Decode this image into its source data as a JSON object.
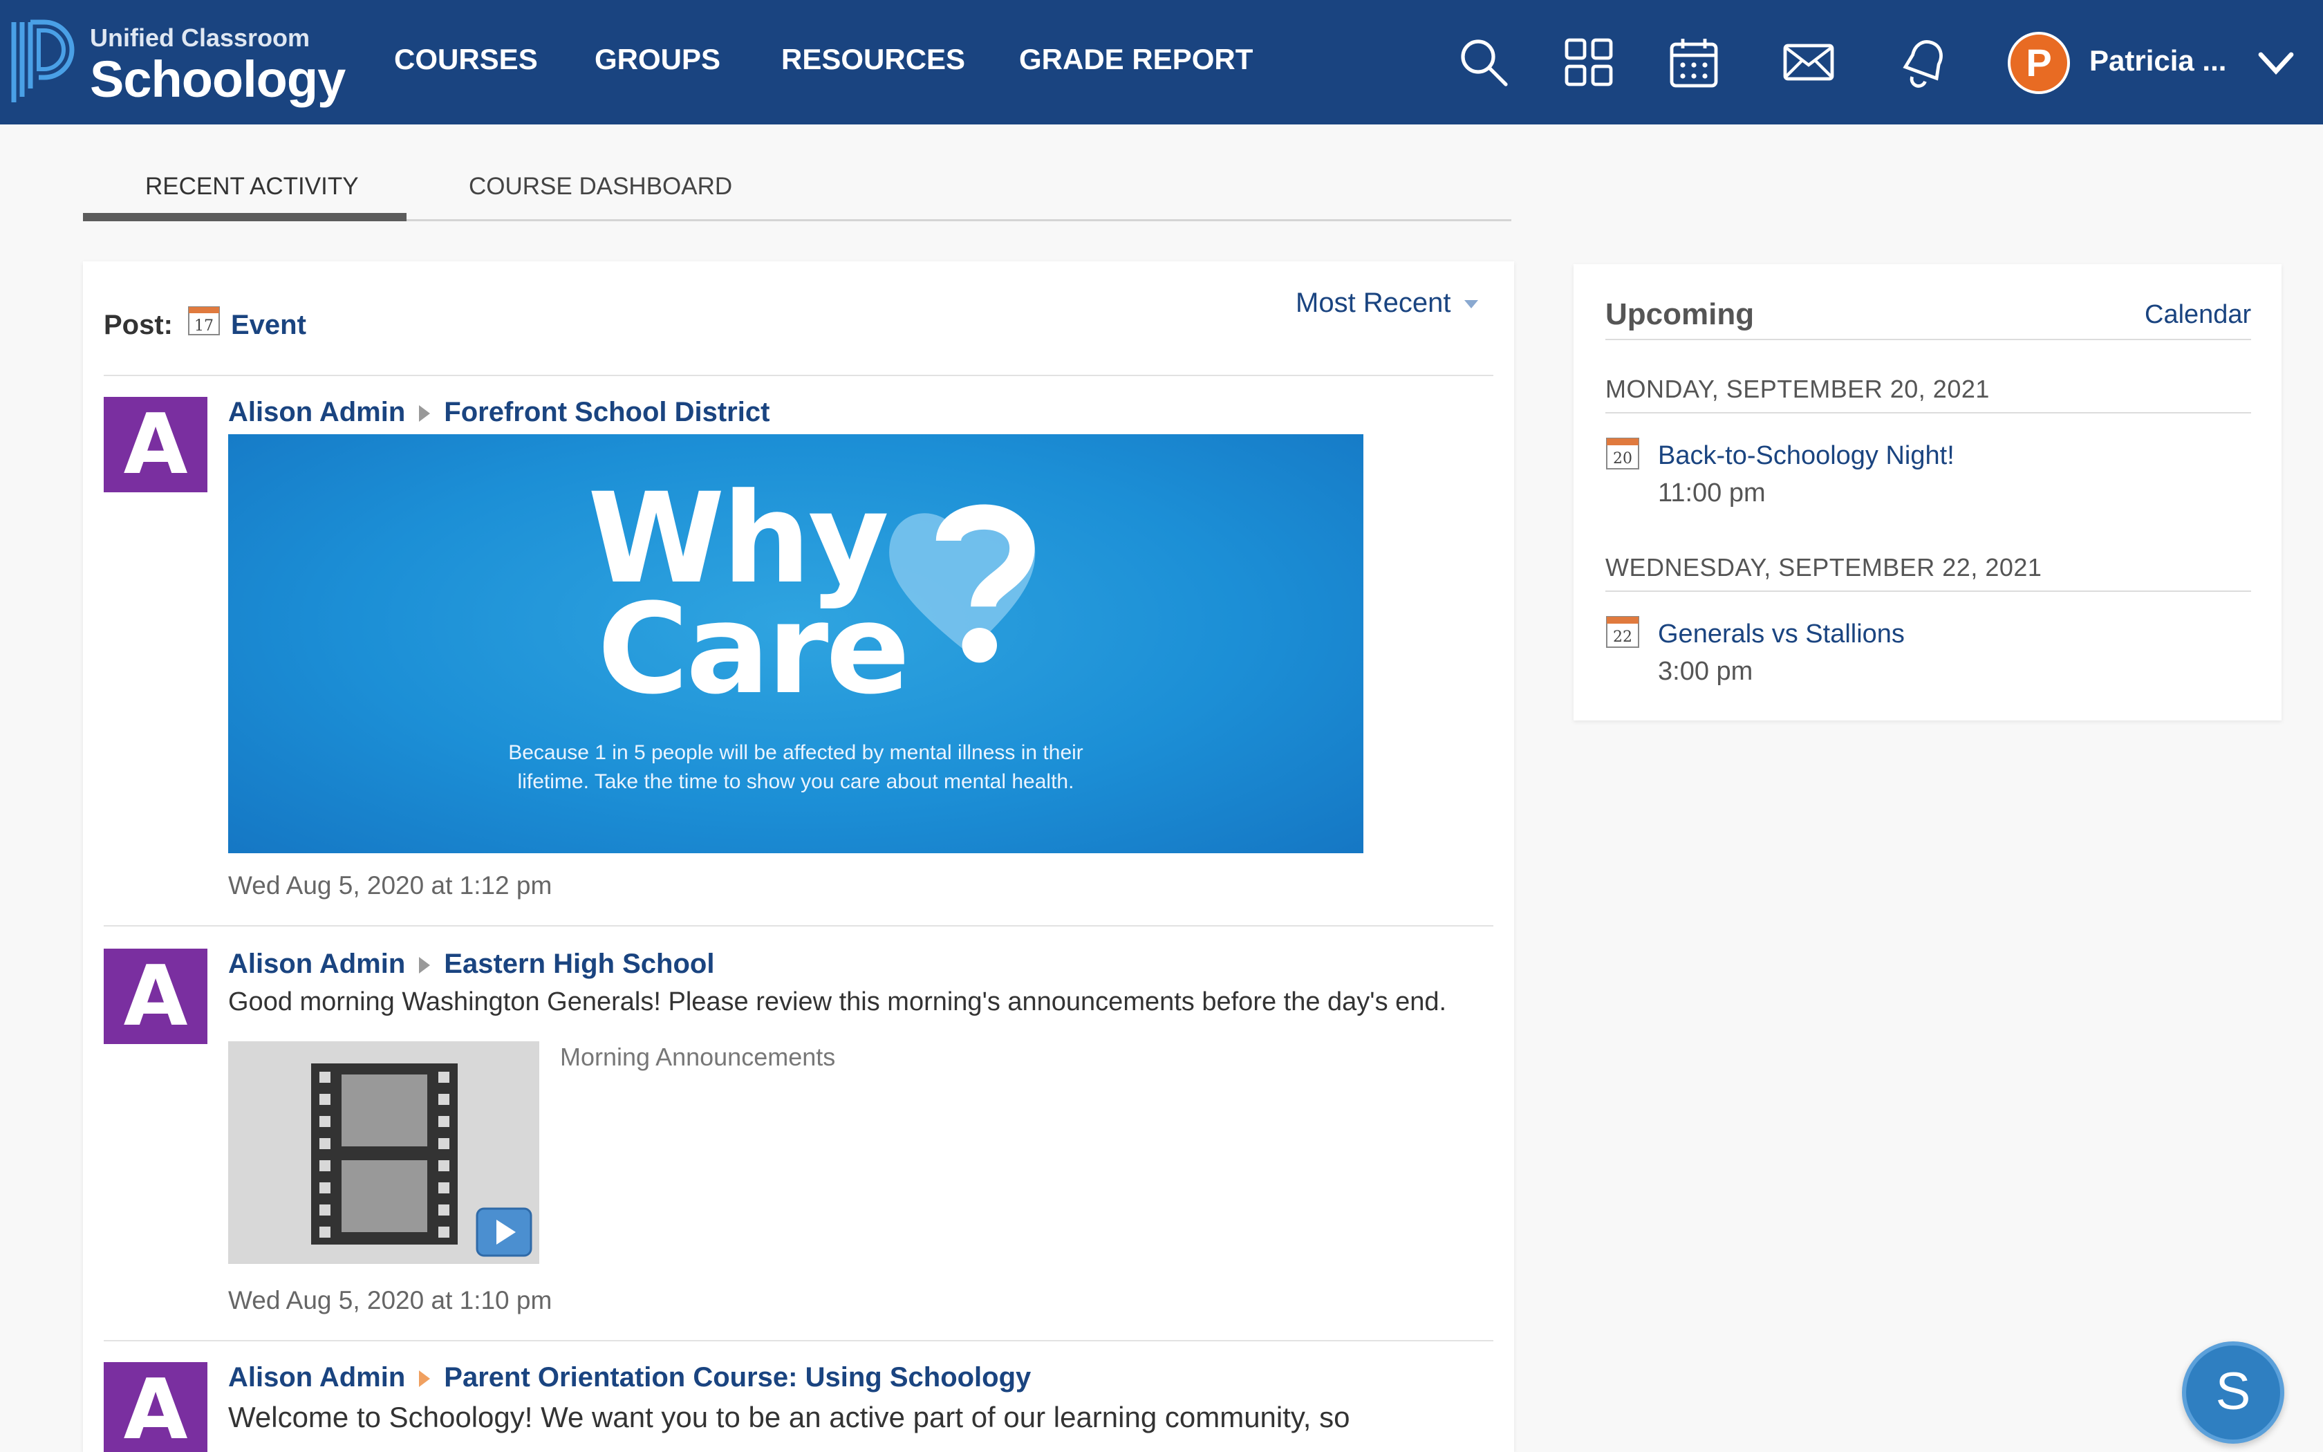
{
  "brand": {
    "subtitle": "Unified Classroom",
    "name": "Schoology"
  },
  "nav": {
    "items": [
      "COURSES",
      "GROUPS",
      "RESOURCES",
      "GRADE REPORT"
    ],
    "user_initial": "P",
    "user_name": "Patricia ...",
    "icons": [
      "search-icon",
      "apps-grid-icon",
      "calendar-icon",
      "mail-icon",
      "notifications-bell-icon",
      "chevron-down-icon"
    ]
  },
  "tabs": [
    "RECENT ACTIVITY",
    "COURSE DASHBOARD"
  ],
  "feed": {
    "post_label": "Post:",
    "event_icon_day": "17",
    "event_label": "Event",
    "sort_label": "Most Recent",
    "posts": [
      {
        "avatar_initial": "A",
        "author": "Alison Admin",
        "target": "Forefront School District",
        "banner": {
          "line1": "Why",
          "line2": "Care",
          "caption": "Because 1 in 5 people will be affected by mental illness in their\nlifetime. Take the time to show you care about mental health."
        },
        "time": "Wed Aug 5, 2020 at 1:12 pm"
      },
      {
        "avatar_initial": "A",
        "author": "Alison Admin",
        "target": "Eastern High School",
        "body": "Good morning Washington Generals! Please review this morning's announcements before the day's end.",
        "attachment_title": "Morning Announcements",
        "time": "Wed Aug 5, 2020 at 1:10 pm"
      },
      {
        "avatar_initial": "A",
        "author": "Alison Admin",
        "target": "Parent Orientation Course: Using Schoology",
        "body": "Welcome to Schoology!  We want you to be an active part of our learning community, so"
      }
    ]
  },
  "upcoming": {
    "title": "Upcoming",
    "calendar_link": "Calendar",
    "days": [
      {
        "date": "MONDAY, SEPTEMBER 20, 2021",
        "icon_day": "20",
        "event": "Back-to-Schoology Night!",
        "time": "11:00 pm"
      },
      {
        "date": "WEDNESDAY, SEPTEMBER 22, 2021",
        "icon_day": "22",
        "event": "Generals vs Stallions",
        "time": "3:00 pm"
      }
    ]
  },
  "help_button": "S",
  "colors": {
    "nav_bg": "#1a4480",
    "link": "#1a4480",
    "avatar_purple": "#7a2fa0",
    "user_orange": "#e86b23",
    "banner_blue": "#1c8fd6"
  }
}
